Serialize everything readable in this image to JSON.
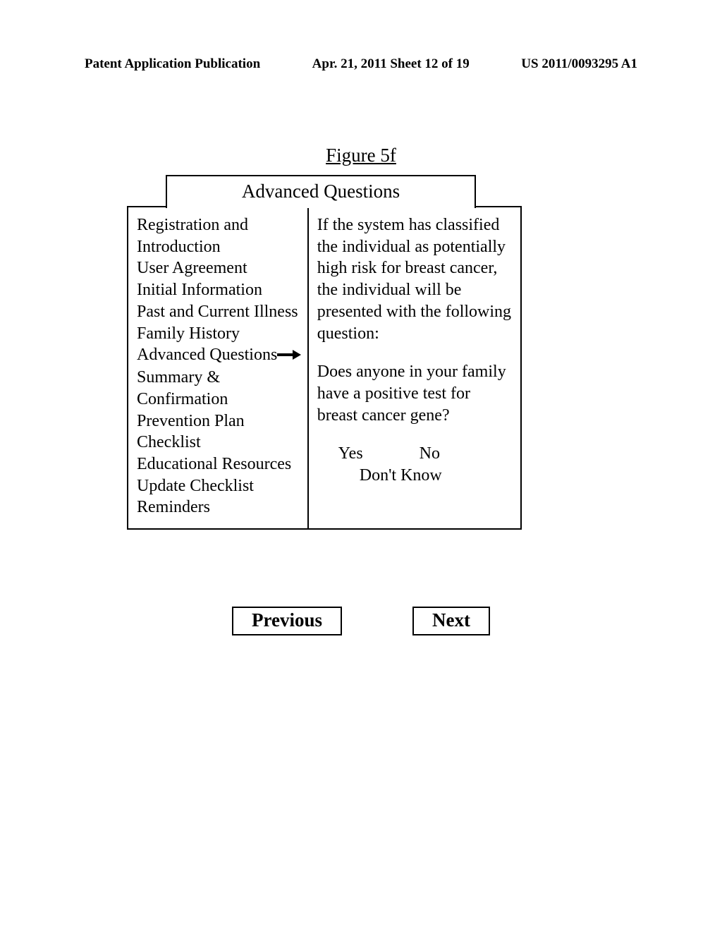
{
  "header": {
    "left": "Patent Application Publication",
    "center": "Apr. 21, 2011  Sheet 12 of 19",
    "right": "US 2011/0093295 A1"
  },
  "figure_title": "Figure 5f",
  "box_title": "Advanced Questions",
  "nav": {
    "items": [
      "Registration and Introduction",
      "User Agreement",
      "Initial Information",
      "Past and Current Illness",
      "Family History",
      "Advanced Questions",
      "Summary & Confirmation",
      "Prevention Plan",
      "Checklist",
      "Educational Resources",
      "Update Checklist",
      "Reminders"
    ]
  },
  "content": {
    "intro": "If the system has classified the individual as potentially high risk for breast cancer, the individual will be presented with the following question:",
    "question": "Does anyone in your family have a positive test for breast cancer gene?",
    "answers": {
      "yes": "Yes",
      "no": "No",
      "dont_know": "Don't Know"
    }
  },
  "buttons": {
    "previous": "Previous",
    "next": "Next"
  }
}
